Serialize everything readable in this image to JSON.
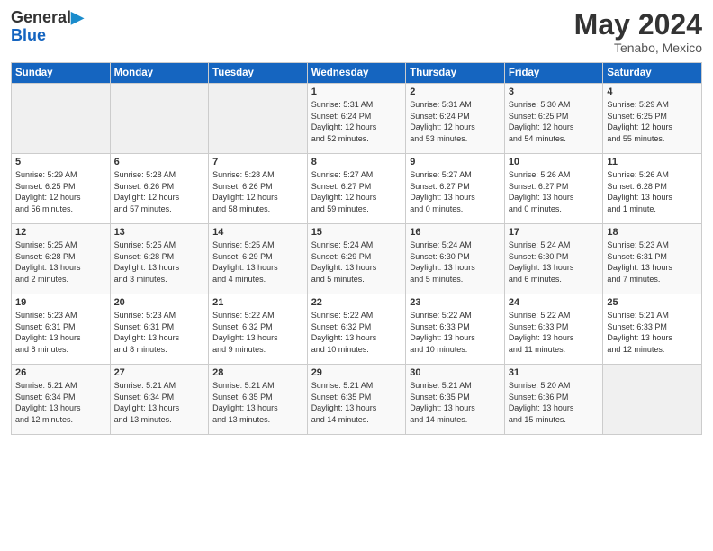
{
  "logo": {
    "general": "General",
    "blue": "Blue"
  },
  "header": {
    "month_year": "May 2024",
    "location": "Tenabo, Mexico"
  },
  "days_of_week": [
    "Sunday",
    "Monday",
    "Tuesday",
    "Wednesday",
    "Thursday",
    "Friday",
    "Saturday"
  ],
  "weeks": [
    [
      {
        "day": "",
        "info": ""
      },
      {
        "day": "",
        "info": ""
      },
      {
        "day": "",
        "info": ""
      },
      {
        "day": "1",
        "info": "Sunrise: 5:31 AM\nSunset: 6:24 PM\nDaylight: 12 hours\nand 52 minutes."
      },
      {
        "day": "2",
        "info": "Sunrise: 5:31 AM\nSunset: 6:24 PM\nDaylight: 12 hours\nand 53 minutes."
      },
      {
        "day": "3",
        "info": "Sunrise: 5:30 AM\nSunset: 6:25 PM\nDaylight: 12 hours\nand 54 minutes."
      },
      {
        "day": "4",
        "info": "Sunrise: 5:29 AM\nSunset: 6:25 PM\nDaylight: 12 hours\nand 55 minutes."
      }
    ],
    [
      {
        "day": "5",
        "info": "Sunrise: 5:29 AM\nSunset: 6:25 PM\nDaylight: 12 hours\nand 56 minutes."
      },
      {
        "day": "6",
        "info": "Sunrise: 5:28 AM\nSunset: 6:26 PM\nDaylight: 12 hours\nand 57 minutes."
      },
      {
        "day": "7",
        "info": "Sunrise: 5:28 AM\nSunset: 6:26 PM\nDaylight: 12 hours\nand 58 minutes."
      },
      {
        "day": "8",
        "info": "Sunrise: 5:27 AM\nSunset: 6:27 PM\nDaylight: 12 hours\nand 59 minutes."
      },
      {
        "day": "9",
        "info": "Sunrise: 5:27 AM\nSunset: 6:27 PM\nDaylight: 13 hours\nand 0 minutes."
      },
      {
        "day": "10",
        "info": "Sunrise: 5:26 AM\nSunset: 6:27 PM\nDaylight: 13 hours\nand 0 minutes."
      },
      {
        "day": "11",
        "info": "Sunrise: 5:26 AM\nSunset: 6:28 PM\nDaylight: 13 hours\nand 1 minute."
      }
    ],
    [
      {
        "day": "12",
        "info": "Sunrise: 5:25 AM\nSunset: 6:28 PM\nDaylight: 13 hours\nand 2 minutes."
      },
      {
        "day": "13",
        "info": "Sunrise: 5:25 AM\nSunset: 6:28 PM\nDaylight: 13 hours\nand 3 minutes."
      },
      {
        "day": "14",
        "info": "Sunrise: 5:25 AM\nSunset: 6:29 PM\nDaylight: 13 hours\nand 4 minutes."
      },
      {
        "day": "15",
        "info": "Sunrise: 5:24 AM\nSunset: 6:29 PM\nDaylight: 13 hours\nand 5 minutes."
      },
      {
        "day": "16",
        "info": "Sunrise: 5:24 AM\nSunset: 6:30 PM\nDaylight: 13 hours\nand 5 minutes."
      },
      {
        "day": "17",
        "info": "Sunrise: 5:24 AM\nSunset: 6:30 PM\nDaylight: 13 hours\nand 6 minutes."
      },
      {
        "day": "18",
        "info": "Sunrise: 5:23 AM\nSunset: 6:31 PM\nDaylight: 13 hours\nand 7 minutes."
      }
    ],
    [
      {
        "day": "19",
        "info": "Sunrise: 5:23 AM\nSunset: 6:31 PM\nDaylight: 13 hours\nand 8 minutes."
      },
      {
        "day": "20",
        "info": "Sunrise: 5:23 AM\nSunset: 6:31 PM\nDaylight: 13 hours\nand 8 minutes."
      },
      {
        "day": "21",
        "info": "Sunrise: 5:22 AM\nSunset: 6:32 PM\nDaylight: 13 hours\nand 9 minutes."
      },
      {
        "day": "22",
        "info": "Sunrise: 5:22 AM\nSunset: 6:32 PM\nDaylight: 13 hours\nand 10 minutes."
      },
      {
        "day": "23",
        "info": "Sunrise: 5:22 AM\nSunset: 6:33 PM\nDaylight: 13 hours\nand 10 minutes."
      },
      {
        "day": "24",
        "info": "Sunrise: 5:22 AM\nSunset: 6:33 PM\nDaylight: 13 hours\nand 11 minutes."
      },
      {
        "day": "25",
        "info": "Sunrise: 5:21 AM\nSunset: 6:33 PM\nDaylight: 13 hours\nand 12 minutes."
      }
    ],
    [
      {
        "day": "26",
        "info": "Sunrise: 5:21 AM\nSunset: 6:34 PM\nDaylight: 13 hours\nand 12 minutes."
      },
      {
        "day": "27",
        "info": "Sunrise: 5:21 AM\nSunset: 6:34 PM\nDaylight: 13 hours\nand 13 minutes."
      },
      {
        "day": "28",
        "info": "Sunrise: 5:21 AM\nSunset: 6:35 PM\nDaylight: 13 hours\nand 13 minutes."
      },
      {
        "day": "29",
        "info": "Sunrise: 5:21 AM\nSunset: 6:35 PM\nDaylight: 13 hours\nand 14 minutes."
      },
      {
        "day": "30",
        "info": "Sunrise: 5:21 AM\nSunset: 6:35 PM\nDaylight: 13 hours\nand 14 minutes."
      },
      {
        "day": "31",
        "info": "Sunrise: 5:20 AM\nSunset: 6:36 PM\nDaylight: 13 hours\nand 15 minutes."
      },
      {
        "day": "",
        "info": ""
      }
    ]
  ]
}
